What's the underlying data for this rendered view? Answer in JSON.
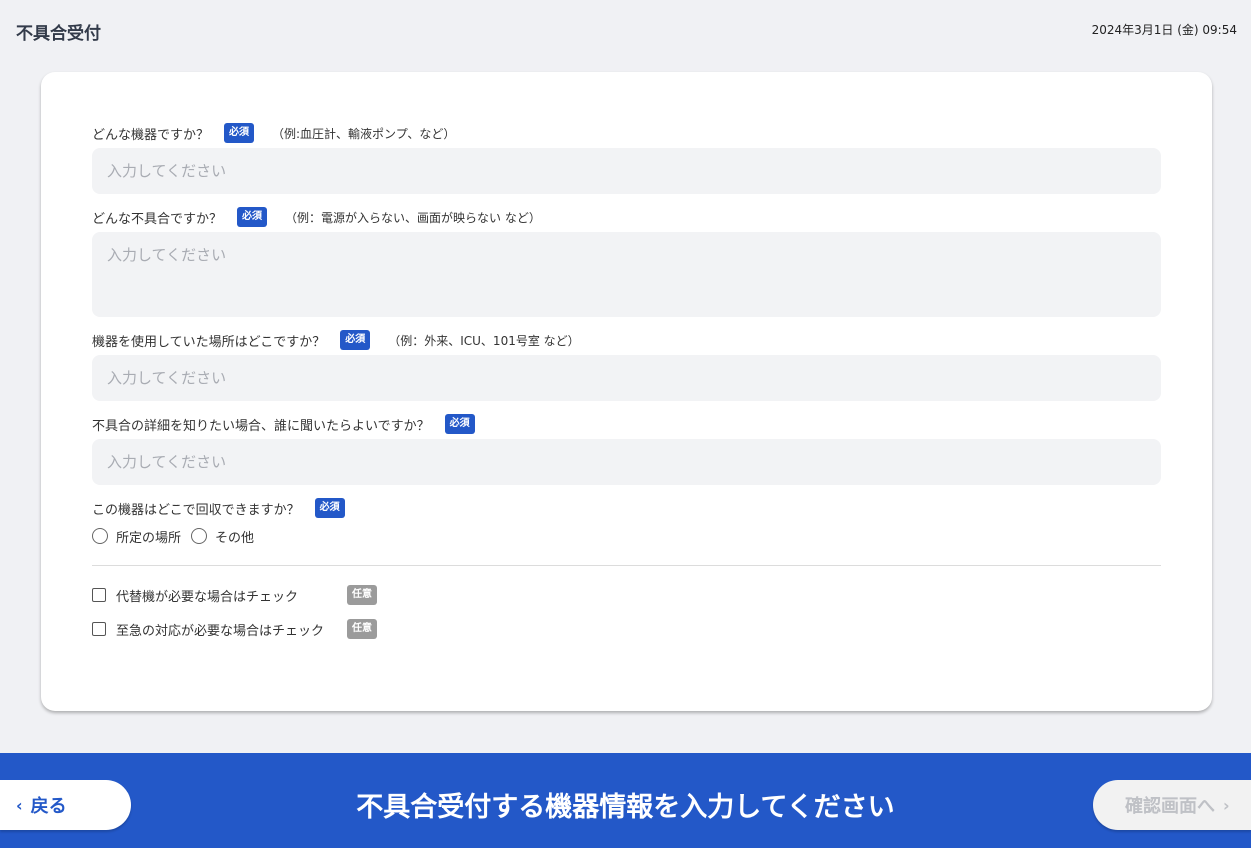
{
  "header": {
    "title": "不具合受付",
    "datetime": "2024年3月1日 (金) 09:54"
  },
  "form": {
    "device": {
      "label": "どんな機器ですか？",
      "badge": "必須",
      "example": "（例:血圧計、輸液ポンプ、など）",
      "value": "",
      "placeholder": "入力してください"
    },
    "problem": {
      "label": "どんな不具合ですか？",
      "badge": "必須",
      "example": "（例：電源が入らない、画面が映らない など）",
      "value": "",
      "placeholder": "入力してください"
    },
    "location": {
      "label": "機器を使用していた場所はどこですか？",
      "badge": "必須",
      "example": "（例：外来、ICU、101号室 など）",
      "value": "",
      "placeholder": "入力してください"
    },
    "contact": {
      "label": "不具合の詳細を知りたい場合、誰に聞いたらよいですか？",
      "badge": "必須",
      "value": "",
      "placeholder": "入力してください"
    },
    "pickup": {
      "label": "この機器はどこで回収できますか？",
      "badge": "必須",
      "options": [
        "所定の場所",
        "その他"
      ],
      "selected": null
    },
    "substitute": {
      "label": "代替機が必要な場合はチェック",
      "badge": "任意",
      "checked": false
    },
    "urgent": {
      "label": "至急の対応が必要な場合はチェック",
      "badge": "任意",
      "checked": false
    }
  },
  "footer": {
    "back_label": "戻る",
    "message": "不具合受付する機器情報を入力してください",
    "next_label": "確認画面へ",
    "accent": "#2358c8"
  }
}
